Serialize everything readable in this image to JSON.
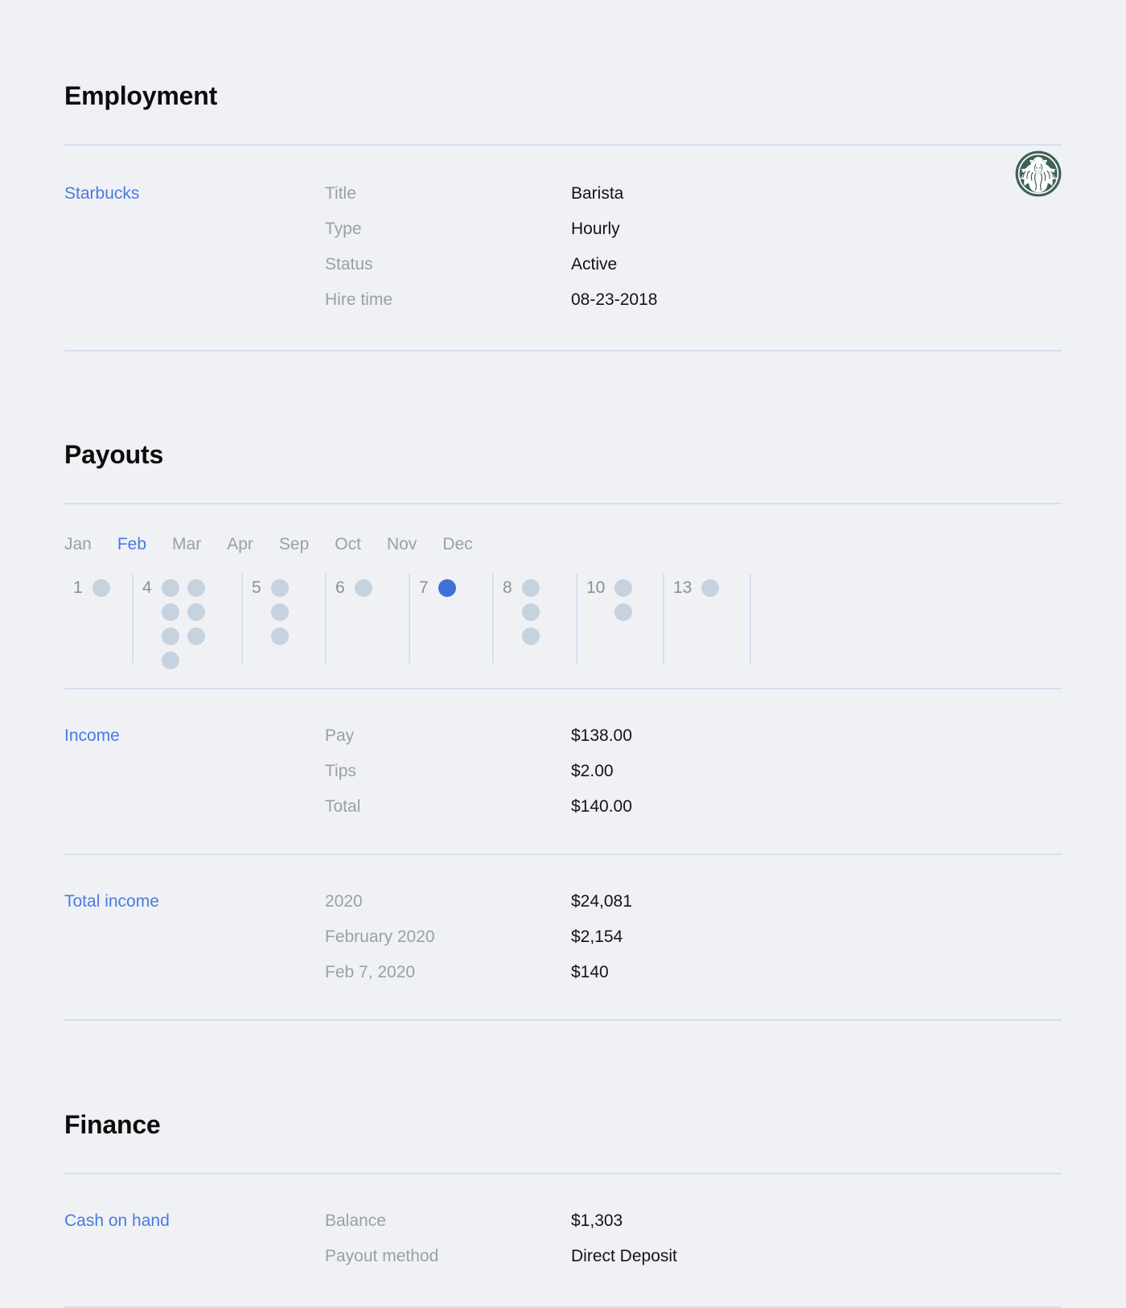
{
  "colors": {
    "background": "#eff1f5",
    "accent": "#4a7ae0",
    "divider": "#d6dfef",
    "muted_text": "#9aa0a8",
    "value_text": "#131416",
    "dot_idle": "#c6d2de",
    "dot_selected": "#4071d4",
    "brand_green": "#3c6255"
  },
  "employment": {
    "heading": "Employment",
    "employer": "Starbucks",
    "logo_icon": "starbucks-siren-logo",
    "fields": [
      {
        "label": "Title",
        "value": "Barista"
      },
      {
        "label": "Type",
        "value": "Hourly"
      },
      {
        "label": "Status",
        "value": "Active"
      },
      {
        "label": "Hire time",
        "value": "08-23-2018"
      }
    ]
  },
  "payouts": {
    "heading": "Payouts",
    "months": [
      {
        "label": "Jan",
        "active": false
      },
      {
        "label": "Feb",
        "active": true
      },
      {
        "label": "Mar",
        "active": false
      },
      {
        "label": "Apr",
        "active": false
      },
      {
        "label": "Sep",
        "active": false
      },
      {
        "label": "Oct",
        "active": false
      },
      {
        "label": "Nov",
        "active": false
      },
      {
        "label": "Dec",
        "active": false
      }
    ],
    "days": [
      {
        "day": "1",
        "columns": [
          1
        ],
        "selected": false
      },
      {
        "day": "4",
        "columns": [
          4,
          3
        ],
        "selected": false
      },
      {
        "day": "5",
        "columns": [
          3
        ],
        "selected": false
      },
      {
        "day": "6",
        "columns": [
          1
        ],
        "selected": false
      },
      {
        "day": "7",
        "columns": [
          1
        ],
        "selected": true
      },
      {
        "day": "8",
        "columns": [
          3
        ],
        "selected": false
      },
      {
        "day": "10",
        "columns": [
          2
        ],
        "selected": false
      },
      {
        "day": "13",
        "columns": [
          1
        ],
        "selected": false
      }
    ],
    "income": {
      "key": "Income",
      "fields": [
        {
          "label": "Pay",
          "value": "$138.00"
        },
        {
          "label": "Tips",
          "value": "$2.00"
        },
        {
          "label": "Total",
          "value": "$140.00"
        }
      ]
    },
    "total_income": {
      "key": "Total income",
      "fields": [
        {
          "label": "2020",
          "value": "$24,081"
        },
        {
          "label": "February 2020",
          "value": "$2,154"
        },
        {
          "label": "Feb 7, 2020",
          "value": "$140"
        }
      ]
    }
  },
  "finance": {
    "heading": "Finance",
    "cash_on_hand": {
      "key": "Cash on hand",
      "fields": [
        {
          "label": "Balance",
          "value": "$1,303"
        },
        {
          "label": "Payout method",
          "value": "Direct Deposit"
        }
      ]
    }
  }
}
